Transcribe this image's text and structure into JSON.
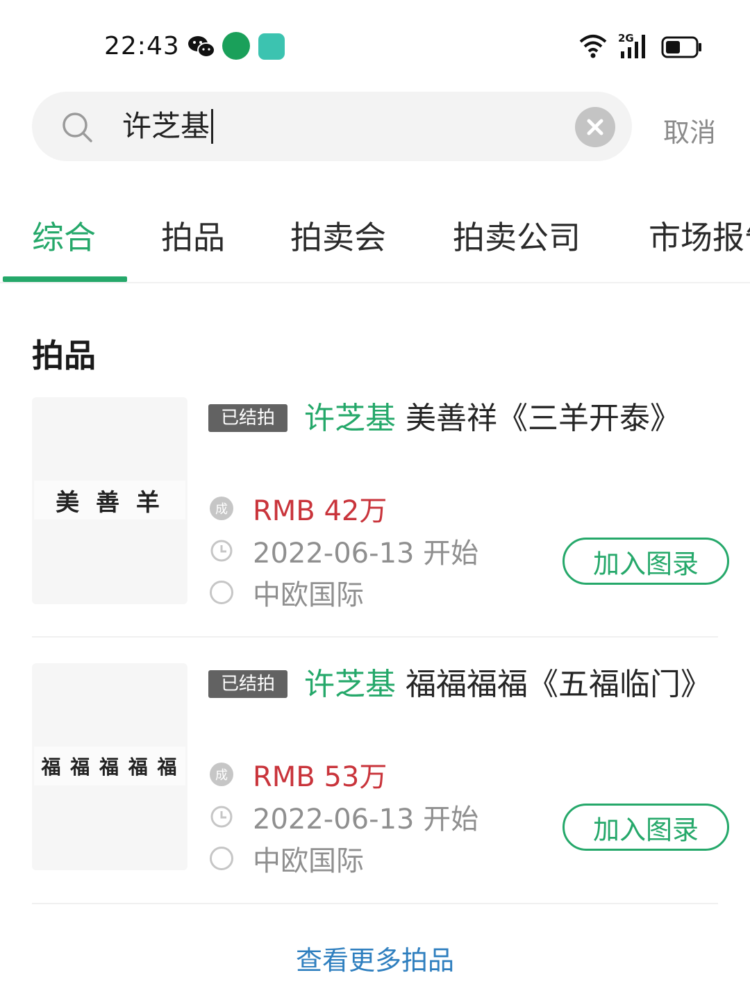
{
  "status_bar": {
    "time": "22:43",
    "network": "2G"
  },
  "search": {
    "query": "许芝基"
  },
  "cancel_label": "取消",
  "tabs": [
    {
      "label": "综合",
      "active": true
    },
    {
      "label": "拍品",
      "active": false
    },
    {
      "label": "拍卖会",
      "active": false
    },
    {
      "label": "拍卖公司",
      "active": false
    },
    {
      "label": "市场报告",
      "active": false
    }
  ],
  "section_title": "拍品",
  "lots": [
    {
      "status": "已结拍",
      "artist": "许芝基",
      "title": " 美善祥《三羊开泰》",
      "thumb_glyphs": "美 善 羊",
      "sold_badge": "成",
      "price": "RMB 42万",
      "date": "2022-06-13 开始",
      "auction_house": "中欧国际",
      "add_label": "加入图录"
    },
    {
      "status": "已结拍",
      "artist": "许芝基",
      "title": " 福福福福《五福临门》",
      "thumb_glyphs": "福 福 福 福 福",
      "sold_badge": "成",
      "price": "RMB 53万",
      "date": "2022-06-13 开始",
      "auction_house": "中欧国际",
      "add_label": "加入图录"
    }
  ],
  "more_link": "查看更多拍品",
  "colors": {
    "accent": "#25a86a",
    "price": "#c9343b",
    "link": "#2f7fbf"
  }
}
